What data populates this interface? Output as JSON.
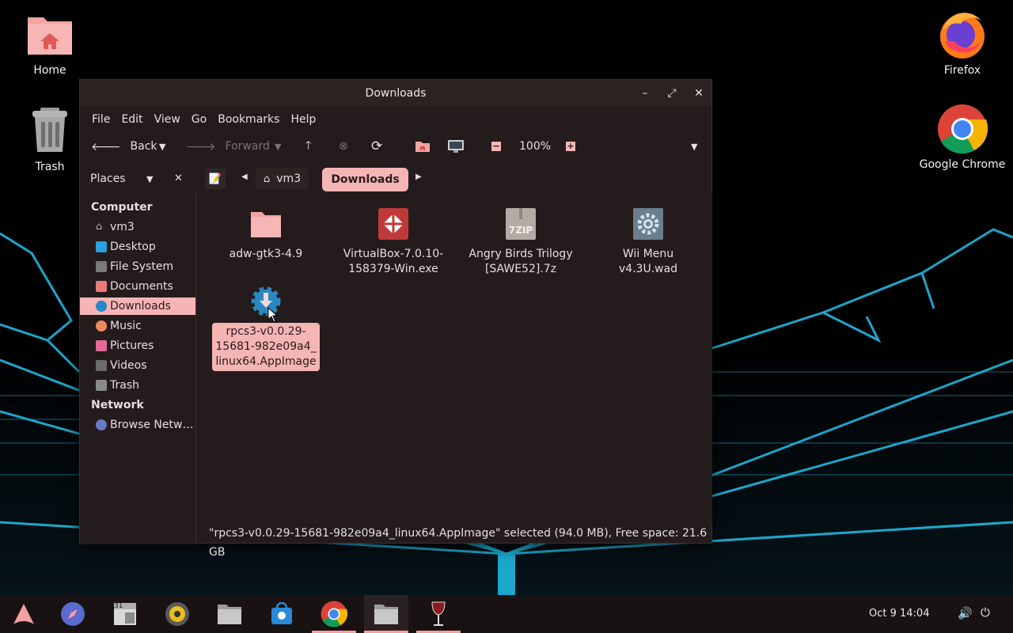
{
  "desktop": {
    "icons": [
      {
        "label": "Home"
      },
      {
        "label": "Trash"
      },
      {
        "label": "Firefox"
      },
      {
        "label": "Google Chrome"
      }
    ]
  },
  "window": {
    "title": "Downloads",
    "controls": {
      "minimize": "–",
      "maximize": "⤢",
      "close": "✕"
    },
    "menu": [
      "File",
      "Edit",
      "View",
      "Go",
      "Bookmarks",
      "Help"
    ],
    "toolbar": {
      "back_label": "Back",
      "forward_label": "Forward",
      "zoom": "100%"
    },
    "places": {
      "label": "Places",
      "sections": {
        "computer": "Computer",
        "network": "Network"
      },
      "items": [
        {
          "label": "vm3",
          "icon": "home-icon"
        },
        {
          "label": "Desktop",
          "icon": "desktop-icon"
        },
        {
          "label": "File System",
          "icon": "drive-icon"
        },
        {
          "label": "Documents",
          "icon": "documents-icon"
        },
        {
          "label": "Downloads",
          "icon": "downloads-icon",
          "active": true
        },
        {
          "label": "Music",
          "icon": "music-icon"
        },
        {
          "label": "Pictures",
          "icon": "pictures-icon"
        },
        {
          "label": "Videos",
          "icon": "videos-icon"
        },
        {
          "label": "Trash",
          "icon": "trash-icon"
        }
      ],
      "network_items": [
        {
          "label": "Browse Netw…",
          "icon": "network-icon"
        }
      ]
    },
    "breadcrumb": {
      "home": "vm3",
      "current": "Downloads"
    },
    "files": [
      {
        "name": "adw-gtk3-4.9",
        "icon": "folder-icon"
      },
      {
        "name": "VirtualBox-7.0.10-158379-Win.exe",
        "line1": "VirtualBox-7.0.10-",
        "line2": "158379-Win.exe",
        "icon": "exe-icon"
      },
      {
        "name": "Angry Birds Trilogy [SAWE52].7z",
        "line1": "Angry Birds Trilogy",
        "line2": "[SAWE52].7z",
        "icon": "archive-icon",
        "icon_text": "7ZIP"
      },
      {
        "name": "Wii Menu v4.3U.wad",
        "icon": "settings-file-icon"
      },
      {
        "name": "rpcs3-v0.0.29-15681-982e09a4_linux64.AppImage",
        "line1": "rpcs3-v0.0.29-",
        "line2": "15681-982e09a4_",
        "line3": "linux64.AppImage",
        "icon": "appimage-icon",
        "selected": true
      }
    ],
    "status": "\"rpcs3-v0.0.29-15681-982e09a4_linux64.AppImage\" selected (94.0 MB), Free space: 21.6 GB"
  },
  "taskbar": {
    "apps": [
      {
        "name": "arch-menu-icon"
      },
      {
        "name": "browser-compass-icon"
      },
      {
        "name": "calendar-icon",
        "text": "31"
      },
      {
        "name": "rhythmbox-icon"
      },
      {
        "name": "files-icon"
      },
      {
        "name": "software-store-icon"
      },
      {
        "name": "chrome-icon",
        "running": true
      },
      {
        "name": "files-active-icon",
        "running": true
      },
      {
        "name": "wine-icon",
        "running": true
      }
    ],
    "clock": "Oct 9  14:04"
  },
  "colors": {
    "accent": "#f5b5b5",
    "window_bg": "#241c1c",
    "titlebar": "#2c2222",
    "taskbar": "#181212"
  }
}
